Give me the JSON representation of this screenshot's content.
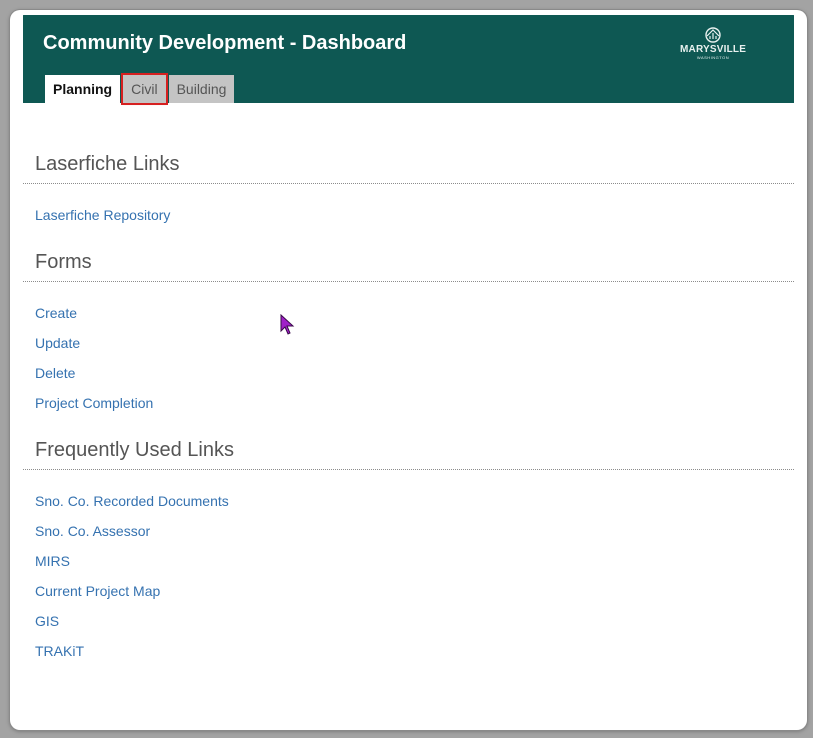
{
  "header": {
    "title": "Community Development - Dashboard",
    "background_color": "#0e5853",
    "logo": {
      "text": "MARYSVILLE",
      "subtext": "WASHINGTON",
      "icon": "city-emblem-icon"
    }
  },
  "tabs": [
    {
      "label": "Planning",
      "active": true
    },
    {
      "label": "Civil",
      "active": false,
      "highlighted": true,
      "highlight_color": "#d62020"
    },
    {
      "label": "Building",
      "active": false
    }
  ],
  "sections": {
    "laserfiche": {
      "heading": "Laserfiche Links",
      "links": [
        "Laserfiche Repository"
      ]
    },
    "forms": {
      "heading": "Forms",
      "links": [
        "Create",
        "Update",
        "Delete",
        "Project Completion"
      ]
    },
    "frequent": {
      "heading": "Frequently Used Links",
      "links": [
        "Sno. Co. Recorded Documents",
        "Sno. Co. Assessor",
        "MIRS",
        "Current Project Map",
        "GIS",
        "TRAKiT"
      ]
    }
  },
  "colors": {
    "link": "#3572b0",
    "heading": "#555555",
    "cursor": "#a020c8"
  },
  "cursor": {
    "icon": "mouse-pointer-icon"
  }
}
